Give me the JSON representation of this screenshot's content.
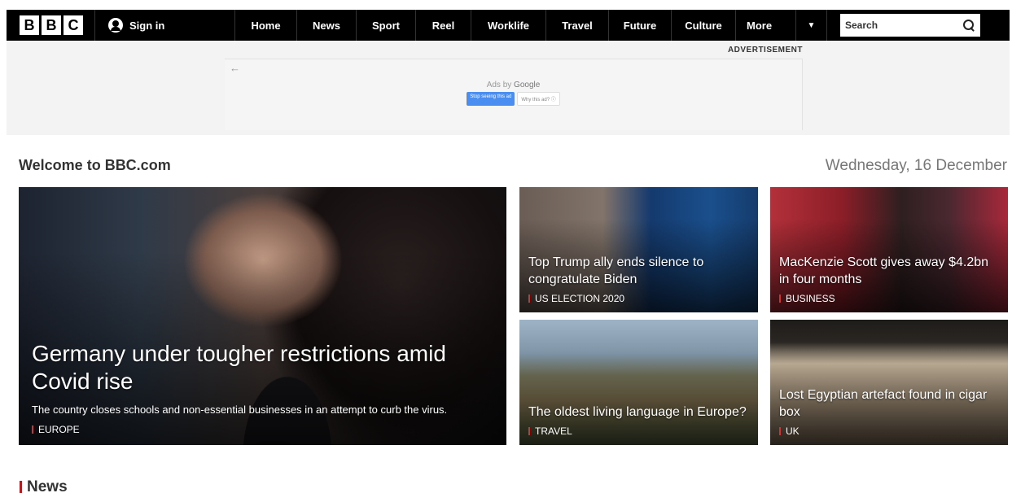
{
  "logo": {
    "letters": [
      "B",
      "B",
      "C"
    ]
  },
  "header": {
    "signin_label": "Sign in",
    "nav": [
      {
        "label": "Home"
      },
      {
        "label": "News"
      },
      {
        "label": "Sport"
      },
      {
        "label": "Reel"
      },
      {
        "label": "Worklife"
      },
      {
        "label": "Travel"
      },
      {
        "label": "Future"
      },
      {
        "label": "Culture"
      },
      {
        "label": "More"
      }
    ],
    "search_placeholder": "Search",
    "icons": {
      "user": "user-icon",
      "search": "search-icon",
      "more": "caret-down-icon"
    }
  },
  "ad": {
    "label": "ADVERTISEMENT",
    "ads_by": "Ads by",
    "google": "Google",
    "stop_label": "Stop seeing this ad",
    "why_label": "Why this ad? ⓘ",
    "back_icon": "arrow-left-icon"
  },
  "welcome": {
    "title": "Welcome to BBC.com",
    "date": "Wednesday, 16 December"
  },
  "hero": {
    "headline": "Germany under tougher restrictions amid Covid rise",
    "summary": "The country closes schools and non-essential businesses in an attempt to curb the virus.",
    "tag": "EUROPE"
  },
  "stories": [
    {
      "headline": "Top Trump ally ends silence to congratulate Biden",
      "tag": "US ELECTION 2020"
    },
    {
      "headline": "MacKenzie Scott gives away $4.2bn in four months",
      "tag": "BUSINESS"
    },
    {
      "headline": "The oldest living language in Europe?",
      "tag": "TRAVEL"
    },
    {
      "headline": "Lost Egyptian artefact found in cigar box",
      "tag": "UK"
    }
  ],
  "section": {
    "title": "News"
  },
  "colors": {
    "brand_black": "#000000",
    "tag_red": "#bb1919",
    "ad_blue": "#4a8ef1"
  }
}
